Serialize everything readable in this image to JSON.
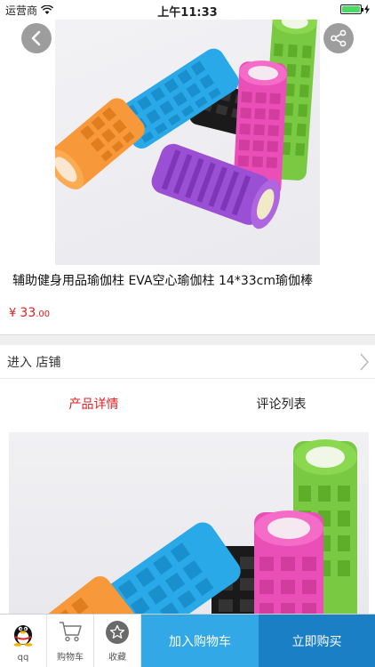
{
  "status_bar": {
    "carrier": "运营商",
    "time": "上午11:33"
  },
  "product": {
    "title": "辅助健身用品瑜伽柱 EVA空心瑜伽柱 14*33cm瑜伽棒",
    "price_symbol": "¥",
    "price_int": "33",
    "price_dec": ".00"
  },
  "store_row": {
    "label": "进入 店铺"
  },
  "tabs": [
    {
      "label": "产品详情"
    },
    {
      "label": "评论列表"
    }
  ],
  "bottom_bar": {
    "qq_label": "qq",
    "cart_label": "购物车",
    "favorite_label": "收藏",
    "add_to_cart": "加入购物车",
    "buy_now": "立即购买"
  },
  "colors": {
    "accent_red": "#e02020",
    "cart_blue": "#33a8e6",
    "buy_blue": "#1b7fc6"
  }
}
